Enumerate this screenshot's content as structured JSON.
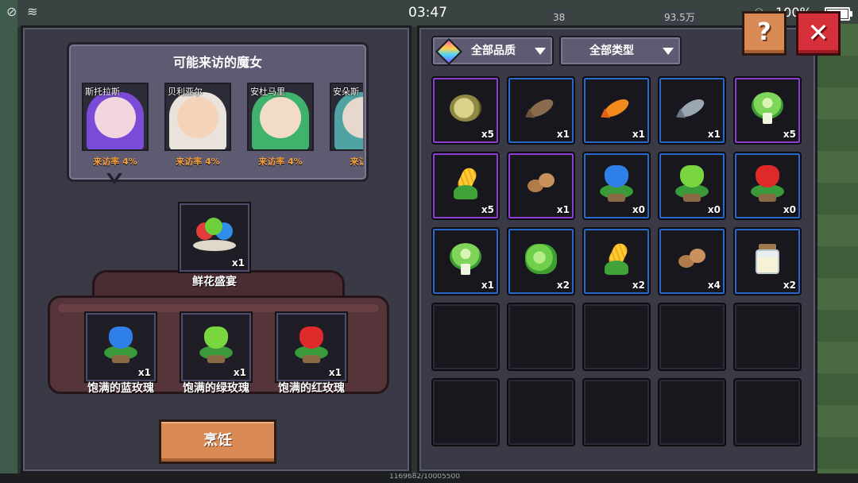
{
  "status_bar": {
    "time": "03:47",
    "battery": "100%",
    "hud_left_value": "38",
    "hud_right_value": "93.5万"
  },
  "visitors": {
    "title": "可能来访的魔女",
    "witches": [
      {
        "name": "斯托拉斯",
        "rate": "来访率 4%",
        "hair": "#7a4bd6",
        "skin": "#f3d5e0"
      },
      {
        "name": "贝利亚尔",
        "rate": "来访率 4%",
        "hair": "#eae3dc",
        "skin": "#f5d2b8"
      },
      {
        "name": "安杜马里",
        "rate": "来访率 4%",
        "hair": "#3fb36b",
        "skin": "#f2dcc8"
      },
      {
        "name": "安朵斯",
        "rate": "来访率",
        "hair": "#4fa3a3",
        "skin": "#e6d8cc"
      }
    ]
  },
  "recipe": {
    "result": {
      "name": "鲜花盛宴",
      "count": "x1",
      "icon": "flower-feast-icon"
    },
    "ingredients": [
      {
        "name": "饱满的蓝玫瑰",
        "count": "x1",
        "icon": "blue-rose-icon",
        "color": "#2f7fe8"
      },
      {
        "name": "饱满的绿玫瑰",
        "count": "x1",
        "icon": "green-rose-icon",
        "color": "#6cd03a"
      },
      {
        "name": "饱满的红玫瑰",
        "count": "x1",
        "icon": "red-rose-icon",
        "color": "#e02a2a"
      }
    ],
    "cook_label": "烹饪"
  },
  "filters": {
    "quality": "全部品质",
    "type": "全部类型"
  },
  "inventory": [
    {
      "icon": "pufferfish-icon",
      "count": "x5",
      "rarity": "purple"
    },
    {
      "icon": "brown-fish-icon",
      "count": "x1",
      "rarity": "blue"
    },
    {
      "icon": "goldfish-icon",
      "count": "x1",
      "rarity": "blue"
    },
    {
      "icon": "gray-fish-icon",
      "count": "x1",
      "rarity": "blue"
    },
    {
      "icon": "cabbage-icon",
      "count": "x5",
      "rarity": "purple"
    },
    {
      "icon": "corn-icon",
      "count": "x5",
      "rarity": "purple"
    },
    {
      "icon": "potato-icon",
      "count": "x1",
      "rarity": "purple"
    },
    {
      "icon": "blue-rose-icon",
      "count": "x0",
      "rarity": "blue"
    },
    {
      "icon": "green-rose-icon",
      "count": "x0",
      "rarity": "blue"
    },
    {
      "icon": "red-rose-icon",
      "count": "x0",
      "rarity": "blue"
    },
    {
      "icon": "cabbage-icon",
      "count": "x1",
      "rarity": "blue"
    },
    {
      "icon": "lettuce-icon",
      "count": "x2",
      "rarity": "blue"
    },
    {
      "icon": "corn-icon",
      "count": "x2",
      "rarity": "blue"
    },
    {
      "icon": "potato-icon",
      "count": "x4",
      "rarity": "blue"
    },
    {
      "icon": "jar-icon",
      "count": "x2",
      "rarity": "blue"
    },
    {
      "icon": "",
      "count": "",
      "rarity": "empty"
    },
    {
      "icon": "",
      "count": "",
      "rarity": "empty"
    },
    {
      "icon": "",
      "count": "",
      "rarity": "empty"
    },
    {
      "icon": "",
      "count": "",
      "rarity": "empty"
    },
    {
      "icon": "",
      "count": "",
      "rarity": "empty"
    },
    {
      "icon": "",
      "count": "",
      "rarity": "empty"
    },
    {
      "icon": "",
      "count": "",
      "rarity": "empty"
    },
    {
      "icon": "",
      "count": "",
      "rarity": "empty"
    },
    {
      "icon": "",
      "count": "",
      "rarity": "empty"
    },
    {
      "icon": "",
      "count": "",
      "rarity": "empty"
    }
  ],
  "buttons": {
    "help": "?",
    "close": "✕"
  },
  "footer": {
    "progress_text": "1169682/10005500"
  },
  "colors": {
    "cook_button": "#d98a55",
    "close_button": "#d6303a",
    "rate_text": "#f4a040",
    "rarity_purple": "#8a3fd1",
    "rarity_blue": "#2a68c9"
  }
}
